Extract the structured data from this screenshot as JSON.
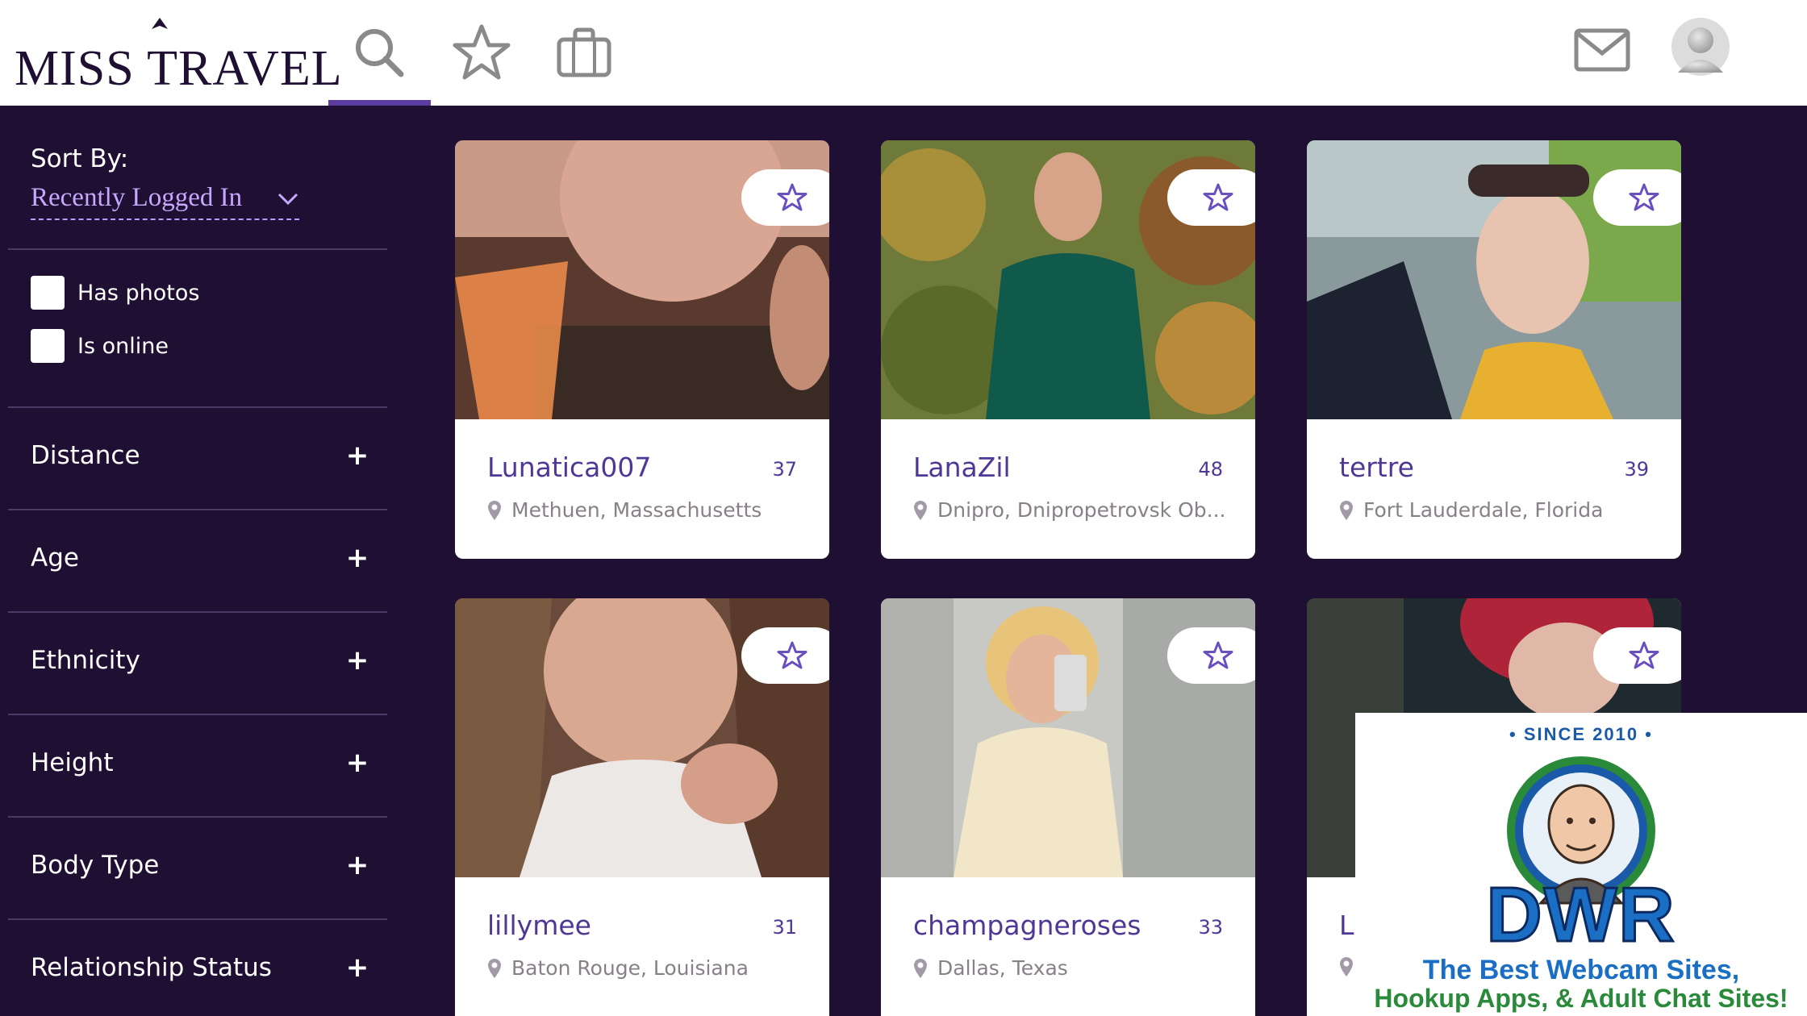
{
  "header": {
    "logo_text": "MISS TRAVEL",
    "nav": [
      {
        "name": "search",
        "icon": "search-icon",
        "active": true
      },
      {
        "name": "favorites",
        "icon": "star-icon",
        "active": false
      },
      {
        "name": "trips",
        "icon": "briefcase-icon",
        "active": false
      }
    ],
    "right": [
      {
        "name": "messages",
        "icon": "mail-icon"
      },
      {
        "name": "profile",
        "icon": "avatar"
      }
    ]
  },
  "sidebar": {
    "sort_label": "Sort By:",
    "sort_value": "Recently Logged In",
    "checkboxes": [
      {
        "label": "Has photos",
        "checked": false
      },
      {
        "label": "Is online",
        "checked": false
      }
    ],
    "filters": [
      {
        "label": "Distance"
      },
      {
        "label": "Age"
      },
      {
        "label": "Ethnicity"
      },
      {
        "label": "Height"
      },
      {
        "label": "Body Type"
      },
      {
        "label": "Relationship Status"
      }
    ],
    "expand_symbol": "+"
  },
  "profiles": [
    {
      "name": "Lunatica007",
      "age": "37",
      "location": "Methuen, Massachusetts"
    },
    {
      "name": "LanaZil",
      "age": "48",
      "location": "Dnipro, Dnipropetrovsk Ob..."
    },
    {
      "name": "tertre",
      "age": "39",
      "location": "Fort Lauderdale, Florida"
    },
    {
      "name": "lillymee",
      "age": "31",
      "location": "Baton Rouge, Louisiana"
    },
    {
      "name": "champagneroses",
      "age": "33",
      "location": "Dallas, Texas"
    },
    {
      "name": "L",
      "age": "",
      "location": ""
    }
  ],
  "badge": {
    "since": "• SINCE 2010 •",
    "brand": "DWR",
    "line1": "The Best Webcam Sites,",
    "line2": "Hookup Apps, & Adult Chat Sites!"
  },
  "colors": {
    "background": "#1f1033",
    "accent": "#5b3da0",
    "link": "#c8a8ff",
    "star": "#6a4fc0"
  }
}
